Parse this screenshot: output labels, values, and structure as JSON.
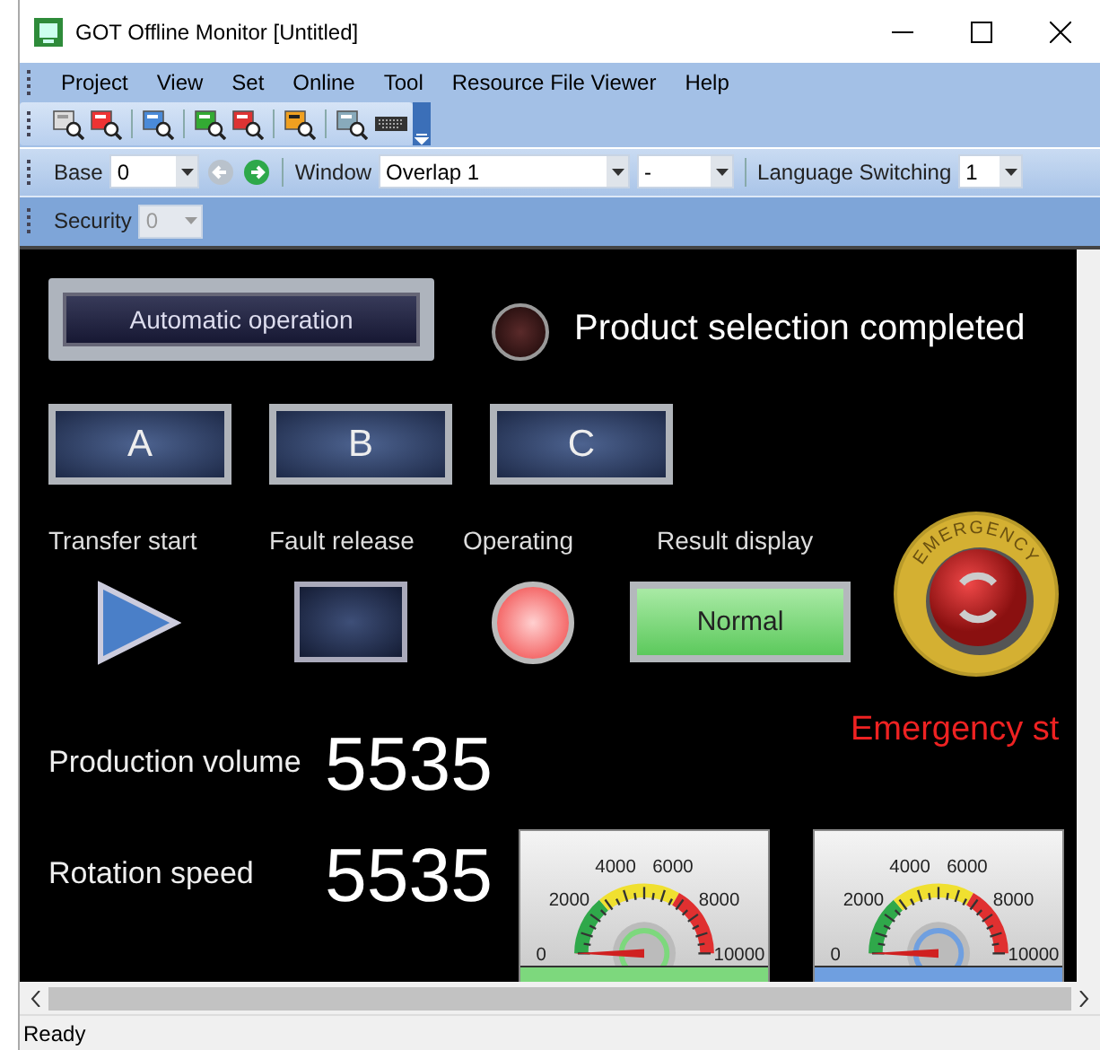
{
  "window": {
    "title": "GOT Offline Monitor  [Untitled]"
  },
  "menu": [
    "Project",
    "View",
    "Set",
    "Online",
    "Tool",
    "Resource File Viewer",
    "Help"
  ],
  "nav_bar": {
    "base_label": "Base",
    "base_value": "0",
    "window_label": "Window",
    "window_value": "Overlap 1",
    "window_sub_value": "-",
    "language_label": "Language Switching",
    "language_value": "1"
  },
  "security": {
    "label": "Security",
    "value": "0",
    "disabled": true
  },
  "hmi": {
    "mode_button": "Automatic operation",
    "status_lamp": {
      "label": "Product selection completed",
      "on": false
    },
    "selector_buttons": [
      "A",
      "B",
      "C"
    ],
    "indicators": [
      {
        "kind": "triangle",
        "label": "Transfer start"
      },
      {
        "kind": "square",
        "label": "Fault release"
      },
      {
        "kind": "lamp",
        "label": "Operating",
        "on": true
      },
      {
        "kind": "result",
        "label": "Result display",
        "value": "Normal"
      }
    ],
    "emergency": {
      "ring_text": "EMERGENCY",
      "label": "Emergency st"
    },
    "readings": [
      {
        "label": "Production volume",
        "value": "5535"
      },
      {
        "label": "Rotation speed",
        "value": "5535"
      }
    ],
    "gauges": [
      {
        "ticks": [
          "0",
          "2000",
          "4000",
          "6000",
          "8000",
          "10000"
        ],
        "color": "#7dd87d"
      },
      {
        "ticks": [
          "0",
          "2000",
          "4000",
          "6000",
          "8000",
          "10000"
        ],
        "color": "#6f9fe0"
      }
    ]
  },
  "status_bar": "Ready"
}
